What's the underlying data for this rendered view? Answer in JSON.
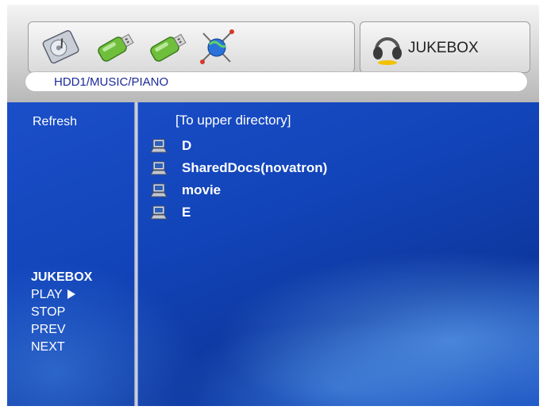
{
  "devices": [
    {
      "name": "hdd-icon"
    },
    {
      "name": "usb-drive-icon"
    },
    {
      "name": "usb-drive-icon"
    },
    {
      "name": "network-satellite-icon"
    }
  ],
  "jukebox_tab": {
    "label": "JUKEBOX",
    "icon": "headphones-icon"
  },
  "path": "HDD1/MUSIC/PIANO",
  "sidebar": {
    "refresh": "Refresh",
    "jukebox_title": "JUKEBOX",
    "play": "PLAY",
    "stop": "STOP",
    "prev": "PREV",
    "next": "NEXT"
  },
  "file_list": {
    "upper": "[To upper directory]",
    "items": [
      "D",
      "SharedDocs(novatron)",
      "movie",
      "E"
    ]
  }
}
